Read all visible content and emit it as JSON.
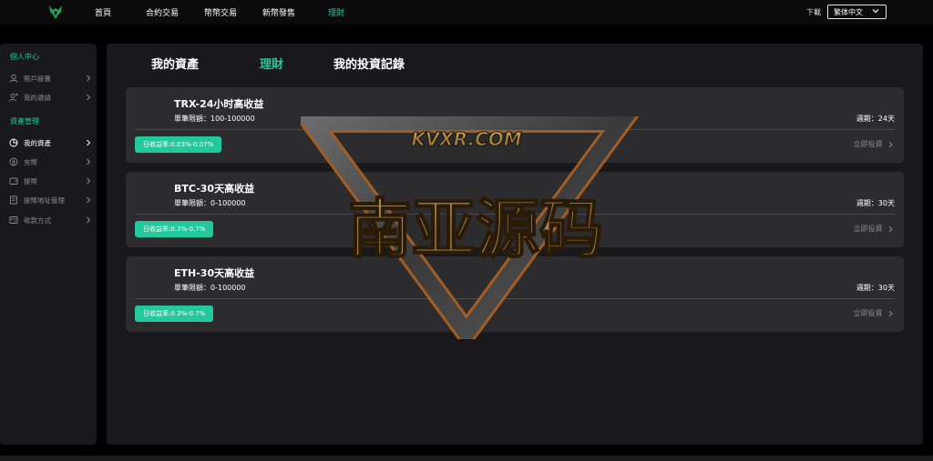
{
  "colors": {
    "accent": "#23c99c",
    "card": "#2c2c2f",
    "panel": "#19191b",
    "muted": "#8c8c8c"
  },
  "nav": {
    "items": [
      {
        "label": "首頁",
        "active": false
      },
      {
        "label": "合約交易",
        "active": false
      },
      {
        "label": "幣幣交易",
        "active": false
      },
      {
        "label": "新幣發售",
        "active": false
      },
      {
        "label": "理財",
        "active": true
      }
    ],
    "download": "下載",
    "language": "繁体中文"
  },
  "sidebar": {
    "personal_heading": "個人中心",
    "personal_items": [
      {
        "label": "賬戶設置",
        "icon": "user-icon"
      },
      {
        "label": "我的邀請",
        "icon": "invite-icon"
      }
    ],
    "asset_heading": "資產管理",
    "asset_items": [
      {
        "label": "我的資產",
        "icon": "pie-chart-icon",
        "active": true
      },
      {
        "label": "充幣",
        "icon": "deposit-icon"
      },
      {
        "label": "提幣",
        "icon": "withdraw-icon"
      },
      {
        "label": "提幣地址管理",
        "icon": "address-book-icon"
      },
      {
        "label": "收款方式",
        "icon": "payment-icon"
      }
    ]
  },
  "tabs": [
    {
      "label": "我的資產",
      "active": false
    },
    {
      "label": "理財",
      "active": true
    },
    {
      "label": "我的投資記錄",
      "active": false
    }
  ],
  "products": [
    {
      "title": "TRX-24小时高收益",
      "limit": "單筆限額：100-100000",
      "period": "週期：24天",
      "rate": "日收益率:0.03%-0.07%",
      "action": "立即投資"
    },
    {
      "title": "BTC-30天高收益",
      "limit": "單筆限額：0-100000",
      "period": "週期：30天",
      "rate": "日收益率:0.3%-0.7%",
      "action": "立即投資"
    },
    {
      "title": "ETH-30天高收益",
      "limit": "單筆限額：0-100000",
      "period": "週期：30天",
      "rate": "日收益率:0.3%-0.7%",
      "action": "立即投資"
    }
  ],
  "watermark": {
    "url_text": "KVXR.COM",
    "main_text": "南亚源码"
  }
}
